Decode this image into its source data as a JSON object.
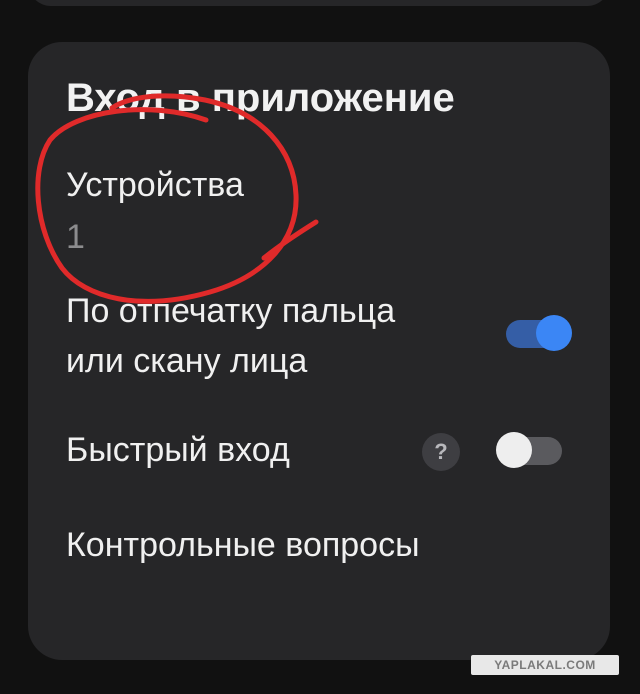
{
  "card": {
    "title": "Вход в приложение",
    "devices": {
      "label": "Устройства",
      "value": "1"
    },
    "fingerprint": {
      "label_line1": "По отпечатку пальца",
      "label_line2": "или скану лица",
      "enabled": true
    },
    "quick_login": {
      "label": "Быстрый вход",
      "help_icon": "?",
      "enabled": false
    },
    "security_questions": {
      "label": "Контрольные вопросы"
    }
  },
  "colors": {
    "background": "#111111",
    "card": "#262628",
    "toggle_on_track": "#355ea6",
    "toggle_on_knob": "#3b86f5",
    "toggle_off_track": "#5a5a5e",
    "toggle_off_knob": "#eeeeee",
    "annotation": "#e02a2a"
  },
  "watermark": {
    "text": "YAPLAKAL.COM"
  }
}
